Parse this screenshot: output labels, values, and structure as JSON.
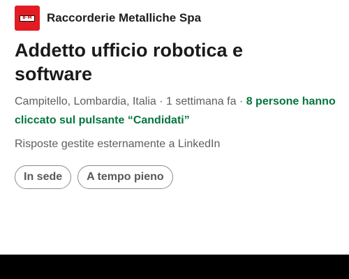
{
  "company": {
    "logo_text": "B·M",
    "name": "Raccorderie Metalliche Spa"
  },
  "job": {
    "title": "Addetto ufficio robotica e software",
    "location": "Campitello, Lombardia, Italia",
    "posted": "1 settimana fa",
    "separator": " · ",
    "applicants": "8 persone hanno cliccato sul pulsante “Candidati”",
    "note": "Risposte gestite esternamente a LinkedIn"
  },
  "chips": [
    {
      "label": "In sede"
    },
    {
      "label": "A tempo pieno"
    }
  ],
  "colors": {
    "brand_red": "#e31b23",
    "applicants_green": "#03753c",
    "meta_gray": "#5e5e5e",
    "bottom_bar": "#000000"
  }
}
